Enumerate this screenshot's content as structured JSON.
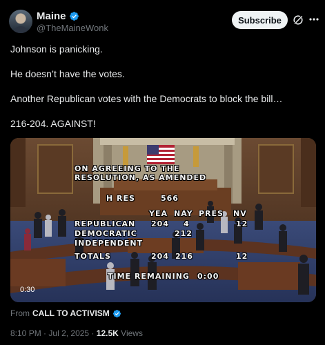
{
  "author": {
    "name": "Maine",
    "handle": "@TheMaineWonk"
  },
  "actions": {
    "subscribe_label": "Subscribe"
  },
  "post": {
    "lines": [
      "Johnson is panicking.",
      "He doesn’t have the votes.",
      "Another Republican votes with the Democrats to block the bill…",
      "216-204. AGAINST!"
    ]
  },
  "media": {
    "duration": "0:30",
    "vote_board": {
      "title_line1": "ON AGREEING TO THE",
      "title_line2": "RESOLUTION, AS AMENDED",
      "measure": "H RES",
      "measure_number": "566",
      "headers": [
        "YEA",
        "NAY",
        "PRES",
        "NV"
      ],
      "rows": [
        {
          "label": "REPUBLICAN",
          "yea": "204",
          "nay": "4",
          "pres": "",
          "nv": "12"
        },
        {
          "label": "DEMOCRATIC",
          "yea": "",
          "nay": "212",
          "pres": "",
          "nv": ""
        },
        {
          "label": "INDEPENDENT",
          "yea": "",
          "nay": "",
          "pres": "",
          "nv": ""
        },
        {
          "label": "TOTALS",
          "yea": "204",
          "nay": "216",
          "pres": "",
          "nv": "12"
        }
      ],
      "time_remaining_label": "TIME REMAINING",
      "time_remaining": "0:00"
    }
  },
  "attribution": {
    "prefix": "From",
    "source": "CALL TO ACTIVISM"
  },
  "meta": {
    "time": "8:10 PM",
    "separator": "·",
    "date": "Jul 2, 2025",
    "views_count": "12.5K",
    "views_label": "Views"
  },
  "colors": {
    "background": "#000000",
    "verified_blue": "#1d9bf0",
    "muted_text": "#71767b"
  }
}
